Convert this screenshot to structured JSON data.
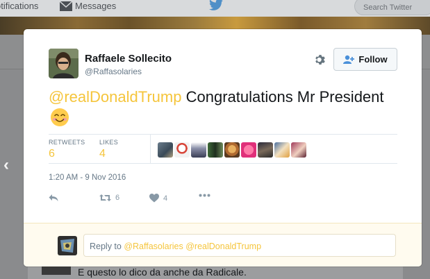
{
  "background": {
    "nav_notifications": "otifications",
    "nav_messages": "Messages",
    "search_placeholder": "Search Twitter",
    "timeline_text": "E questo lo dico da anche da Radicale."
  },
  "tweet": {
    "author_name": "Raffaele Sollecito",
    "author_handle": "@Raffasolaries",
    "follow_label": "Follow",
    "mention": "@realDonaldTrump",
    "body": " Congratulations Mr President ",
    "emoji": "smiling-face-with-smiling-eyes-icon",
    "retweets_label": "RETWEETS",
    "retweets_count": "6",
    "likes_label": "LIKES",
    "likes_count": "4",
    "timestamp": "1:20 AM - 9 Nov 2016",
    "actions": {
      "retweet_count": "6",
      "like_count": "4"
    }
  },
  "reply": {
    "prefix": "Reply to ",
    "mentions": "@Raffasolaries @realDonaldTrump"
  },
  "colors": {
    "accent": "#f5c53c",
    "text": "#14171a",
    "muted": "#657786",
    "reply_bg": "#fffbef"
  }
}
